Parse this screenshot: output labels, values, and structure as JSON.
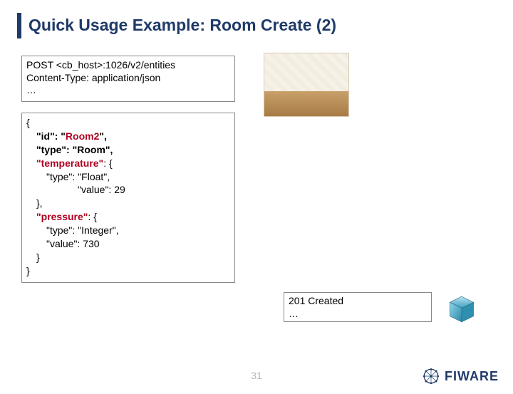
{
  "title": "Quick Usage Example: Room Create (2)",
  "request": {
    "line1": "POST <cb_host>:1026/v2/entities",
    "line2": "Content-Type: application/json",
    "line3": "…"
  },
  "body": {
    "open": "{",
    "id_key": "\"id\": \"",
    "id_val": "Room2",
    "id_close": "\",",
    "type_line": "\"type\": \"Room\",",
    "temp_key": "\"temperature\"",
    "temp_after": ": {",
    "temp_type": "\"type\": \"Float\",",
    "temp_value": "\"value\": 29",
    "temp_close": "},",
    "press_key": "\"pressure\"",
    "press_after": ": {",
    "press_type": "\"type\": \"Integer\",",
    "press_value": "\"value\": 730",
    "press_close": "}",
    "close": "}"
  },
  "response": {
    "line1": "201 Created",
    "line2": "…"
  },
  "page_number": "31",
  "logo_text": "FIWARE"
}
